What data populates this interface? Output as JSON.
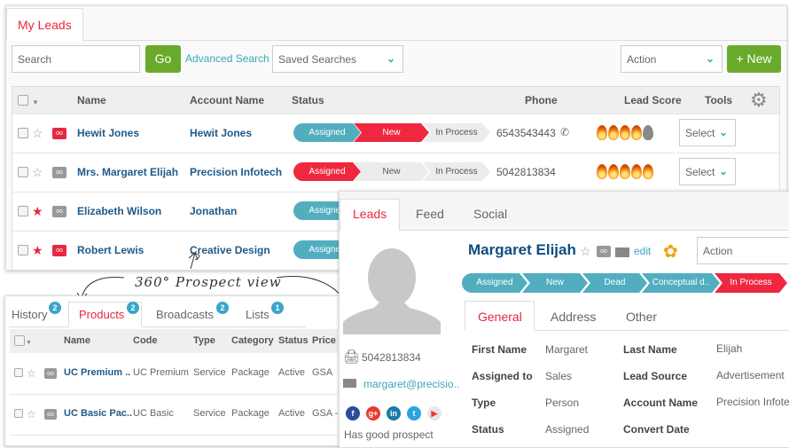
{
  "main": {
    "tab": "My Leads",
    "search_placeholder": "Search",
    "go": "Go",
    "advanced_search": "Advanced Search",
    "saved_searches": "Saved Searches",
    "action": "Action",
    "new": "+ New",
    "columns": [
      "Name",
      "Account Name",
      "Status",
      "Phone",
      "Lead Score",
      "Tools"
    ],
    "rows": [
      {
        "name": "Hewit Jones",
        "account": "Hewit Jones",
        "starred": false,
        "owl": "red",
        "status": [
          "Assigned",
          "New",
          "In Process"
        ],
        "active": 1,
        "phone": "6543543443",
        "score": 4,
        "tool": "Select"
      },
      {
        "name": "Mrs. Margaret Elijah",
        "account": "Precision Infotech",
        "starred": false,
        "owl": "grey",
        "status": [
          "Assigned",
          "New",
          "In Process"
        ],
        "active": 0,
        "phone": "5042813834",
        "score": 5,
        "tool": "Select"
      },
      {
        "name": "Elizabeth Wilson",
        "account": "Jonathan",
        "starred": true,
        "owl": "grey",
        "status": [
          "Assigned"
        ],
        "active": -1,
        "phone": "",
        "score": 0,
        "tool": ""
      },
      {
        "name": "Robert Lewis",
        "account": "Creative Design",
        "starred": true,
        "owl": "red",
        "status": [
          "Assigned"
        ],
        "active": -1,
        "phone": "",
        "score": 0,
        "tool": ""
      }
    ]
  },
  "annotation": "360° Prospect view",
  "products": {
    "tabs": [
      {
        "label": "History",
        "count": "2"
      },
      {
        "label": "Products",
        "count": "2"
      },
      {
        "label": "Broadcasts",
        "count": "2"
      },
      {
        "label": "Lists",
        "count": "1"
      }
    ],
    "columns": [
      "Name",
      "Code",
      "Type",
      "Category",
      "Status",
      "Price"
    ],
    "rows": [
      [
        "UC Premium ..",
        "UC Premium",
        "Service",
        "Package",
        "Active",
        "GSA"
      ],
      [
        "UC Basic Pac..",
        "UC Basic",
        "Service",
        "Package",
        "Active",
        "GSA -"
      ]
    ]
  },
  "detail": {
    "tabs": [
      "Leads",
      "Feed",
      "Social"
    ],
    "name": "Margaret Elijah",
    "edit": "edit",
    "action": "Action",
    "phone": "5042813834",
    "email": "margaret@precisio..",
    "note": "Has good prospect",
    "stages": [
      "Assigned",
      "New",
      "Dead",
      "Conceptual d..",
      "In Process"
    ],
    "subtabs": [
      "General",
      "Address",
      "Other"
    ],
    "fields": [
      {
        "label": "First Name",
        "value": "Margaret",
        "label2": "Last Name",
        "value2": "Elijah"
      },
      {
        "label": "Assigned to",
        "value": "Sales",
        "label2": "Lead Source",
        "value2": "Advertisement"
      },
      {
        "label": "Type",
        "value": "Person",
        "label2": "Account Name",
        "value2": "Precision Infote"
      },
      {
        "label": "Status",
        "value": "Assigned",
        "label2": "Convert Date",
        "value2": ""
      }
    ]
  },
  "colors": {
    "accent": "#e8273f",
    "teal": "#52aebf",
    "green": "#6aaa2a",
    "link": "#1e5a8a"
  }
}
